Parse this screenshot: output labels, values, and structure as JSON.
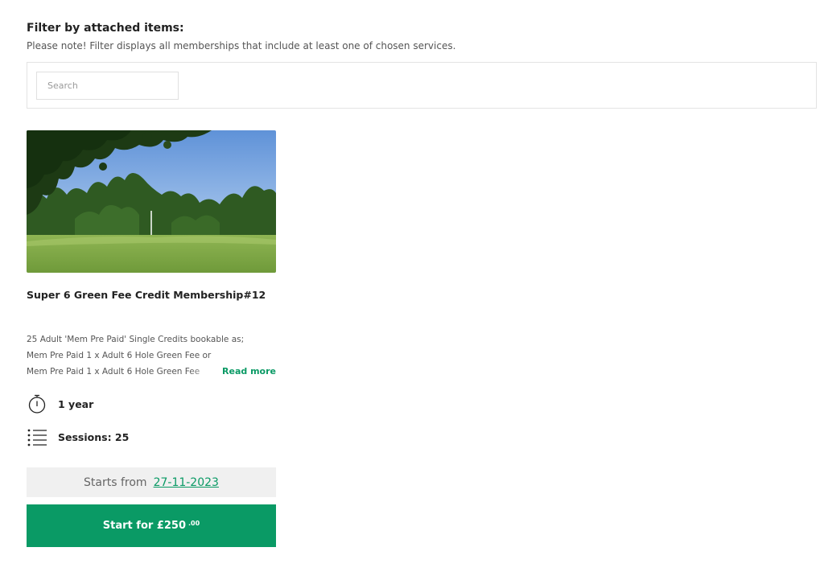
{
  "filter": {
    "title": "Filter by attached items:",
    "note": "Please note! Filter displays all memberships that include at least one of chosen services.",
    "search_placeholder": "Search",
    "search_value": ""
  },
  "card": {
    "title": "Super 6 Green Fee Credit Membership#12",
    "description_lines": [
      "25 Adult 'Mem Pre Paid' Single Credits bookable as;",
      "Mem Pre Paid 1 x Adult 6 Hole Green Fee or",
      "Mem Pre Paid 1 x Adult 6 Hole Green Fee"
    ],
    "read_more": "Read more",
    "duration": "1 year",
    "sessions": "Sessions: 25",
    "starts_from_label": "Starts from",
    "starts_from_date": "27-11-2023",
    "button_main": "Start for £250",
    "button_cents": ".00"
  },
  "colors": {
    "accent": "#0a9a65",
    "starts_bg": "#f0f0f0"
  },
  "icons": {
    "duration": "stopwatch-icon",
    "sessions": "list-icon"
  }
}
